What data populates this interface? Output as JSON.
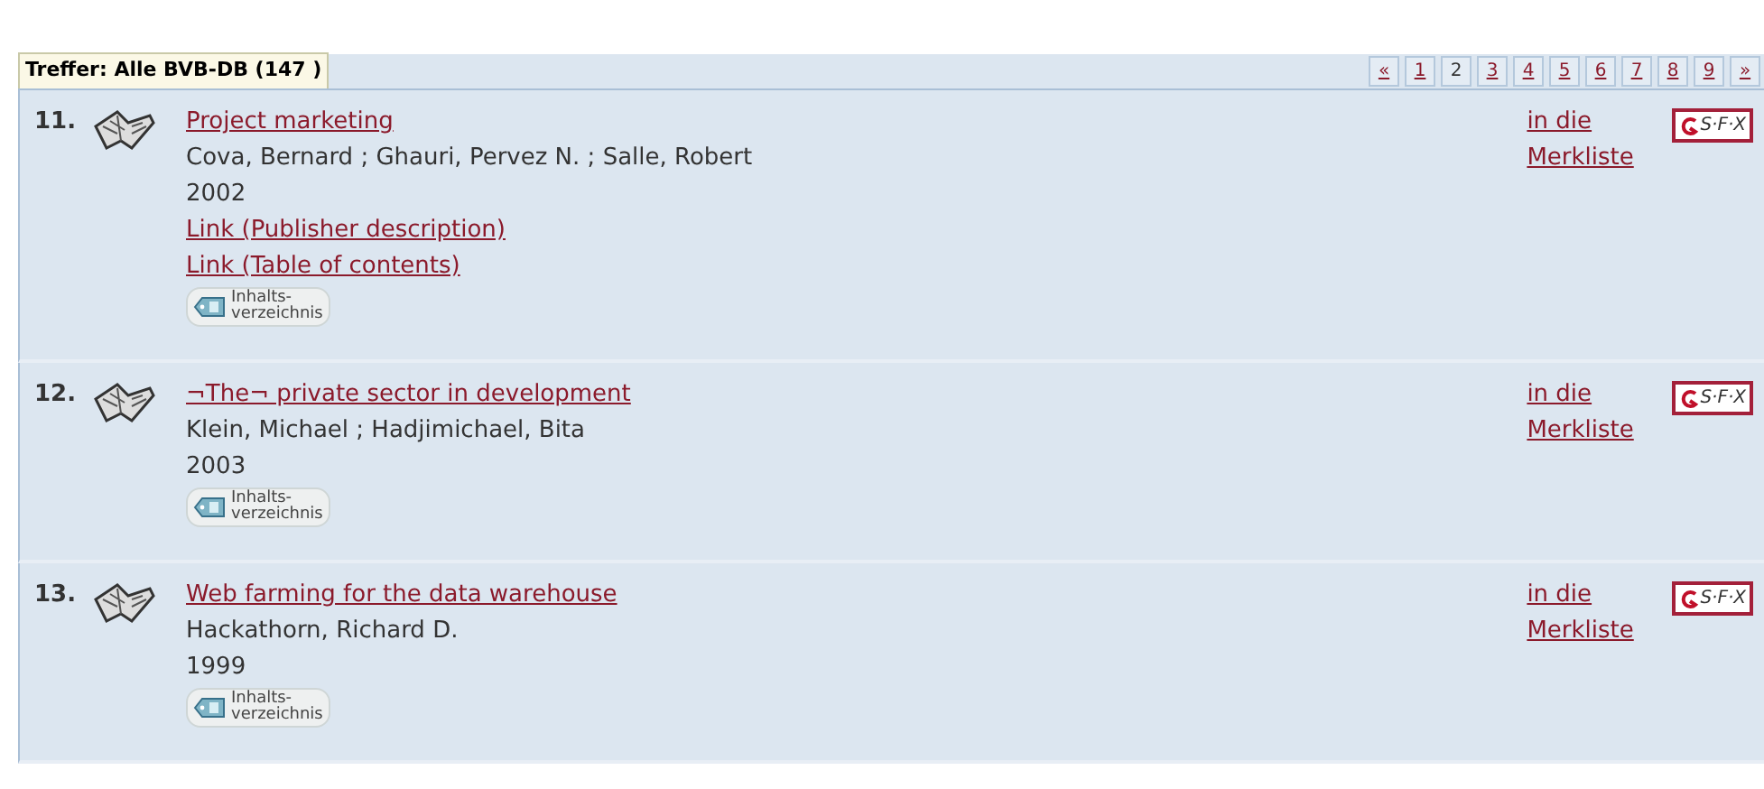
{
  "header": {
    "title": "Treffer: Alle BVB-DB (147 )"
  },
  "pager": [
    {
      "label": "«",
      "selected": false
    },
    {
      "label": "1",
      "selected": false
    },
    {
      "label": "2",
      "selected": true
    },
    {
      "label": "3",
      "selected": false
    },
    {
      "label": "4",
      "selected": false
    },
    {
      "label": "5",
      "selected": false
    },
    {
      "label": "6",
      "selected": false
    },
    {
      "label": "7",
      "selected": false
    },
    {
      "label": "8",
      "selected": false
    },
    {
      "label": "9",
      "selected": false
    },
    {
      "label": "»",
      "selected": false
    }
  ],
  "results": [
    {
      "number": "11.",
      "title": "Project marketing",
      "authors": "Cova, Bernard ; Ghauri, Pervez N. ; Salle, Robert",
      "year": "2002",
      "links": [
        "Link (Publisher description)",
        "Link (Table of contents)"
      ],
      "toc_button": [
        "Inhalts-",
        "verzeichnis"
      ],
      "watchlist": "in die Merkliste",
      "sfx": "S·F·X"
    },
    {
      "number": "12.",
      "title": "¬The¬ private sector in development",
      "authors": "Klein, Michael ; Hadjimichael, Bita",
      "year": "2003",
      "toc_button": [
        "Inhalts-",
        "verzeichnis"
      ],
      "watchlist": "in die Merkliste",
      "sfx": "S·F·X"
    },
    {
      "number": "13.",
      "title": "Web farming for the data warehouse",
      "authors": "Hackathorn, Richard D.",
      "year": "1999",
      "toc_button": [
        "Inhalts-",
        "verzeichnis"
      ],
      "watchlist": "in die Merkliste",
      "sfx": "S·F·X"
    }
  ]
}
